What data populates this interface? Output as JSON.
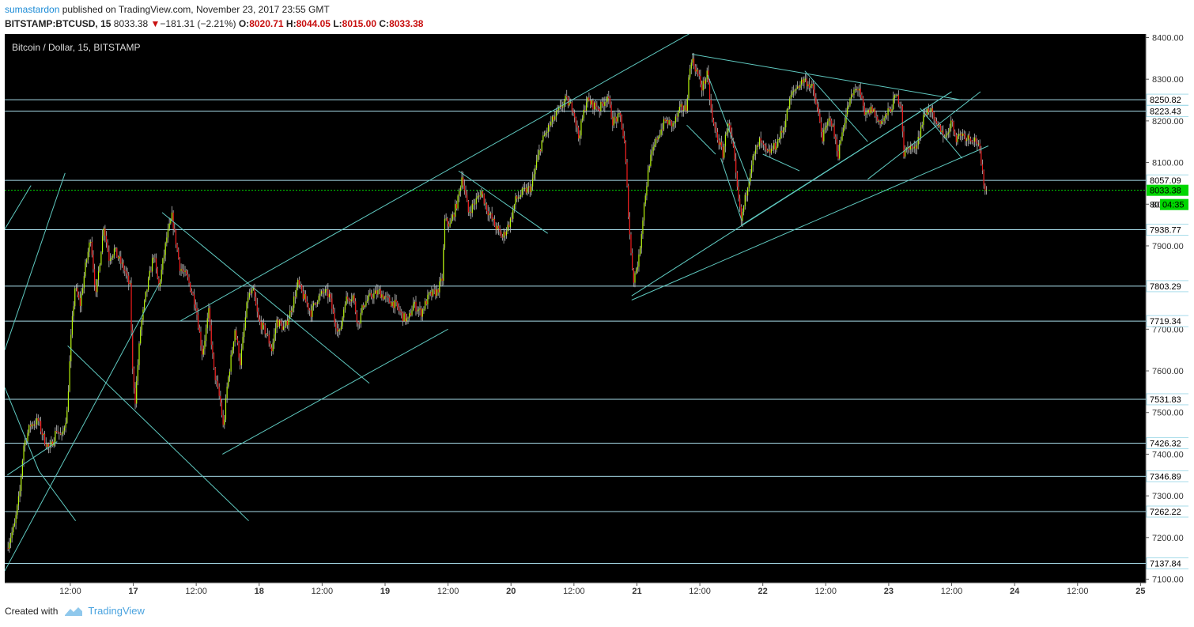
{
  "header": {
    "author": "sumastardon",
    "published_text": "published on TradingView.com, November 23, 2017 23:55 GMT",
    "symbol": "BITSTAMP:BTCUSD, 15",
    "last": "8033.38",
    "change_arrow": "▼",
    "change": "−181.31 (−2.21%)",
    "o_label": "O:",
    "o": "8020.71",
    "h_label": "H:",
    "h": "8044.05",
    "l_label": "L:",
    "l": "8015.00",
    "c_label": "C:",
    "c": "8033.38"
  },
  "footer": {
    "created_with": "Created with",
    "brand": "TradingView"
  },
  "colors": {
    "background": "#000000",
    "up": "#b7f50a",
    "down": "#f21b1b",
    "wick": "#bdbdbd",
    "drawing": "#5fc9c0",
    "hline": "#a8dcea",
    "price_label_bg": "#ffffff",
    "current_price_bg": "#00d600"
  },
  "chart_data": {
    "type": "candlestick",
    "title": "Bitcoin / Dollar, 15, BITSTAMP",
    "ylim": [
      7100,
      8400
    ],
    "y_ticks": [
      "8400.00",
      "8300.00",
      "8200.00",
      "8100.00",
      "8000.00",
      "7900.00",
      "7800.00",
      "7700.00",
      "7600.00",
      "7500.00",
      "7400.00",
      "7300.00",
      "7200.00",
      "7100.00"
    ],
    "x_ticks": [
      "12:00",
      "17",
      "12:00",
      "18",
      "12:00",
      "19",
      "12:00",
      "20",
      "12:00",
      "21",
      "12:00",
      "22",
      "12:00",
      "23",
      "12:00",
      "24",
      "12:00",
      "25"
    ],
    "x_tick_times_hours": [
      12,
      24,
      36,
      48,
      60,
      72,
      84,
      96,
      108,
      120,
      132,
      144,
      156,
      168,
      180,
      192,
      204,
      216
    ],
    "x_range_hours": [
      -0.5,
      217
    ],
    "horizontal_levels": [
      {
        "value": 8250.82,
        "label": "8250.82"
      },
      {
        "value": 8223.43,
        "label": "8223.43"
      },
      {
        "value": 8057.09,
        "label": "8057.09"
      },
      {
        "value": 7938.77,
        "label": "7938.77"
      },
      {
        "value": 7803.29,
        "label": "7803.29"
      },
      {
        "value": 7719.34,
        "label": "7719.34"
      },
      {
        "value": 7531.83,
        "label": "7531.83"
      },
      {
        "value": 7426.32,
        "label": "7426.32"
      },
      {
        "value": 7346.89,
        "label": "7346.89"
      },
      {
        "value": 7262.22,
        "label": "7262.22"
      },
      {
        "value": 7137.84,
        "label": "7137.84"
      }
    ],
    "current_price": {
      "value": 8033.38,
      "label": "8033.38",
      "countdown": "04:35",
      "countdown_prefix": "80"
    },
    "price_path_anchors": [
      [
        0,
        7175
      ],
      [
        1.5,
        7230
      ],
      [
        2.5,
        7310
      ],
      [
        3.2,
        7420
      ],
      [
        4.5,
        7470
      ],
      [
        6,
        7480
      ],
      [
        7,
        7440
      ],
      [
        8.2,
        7410
      ],
      [
        9.5,
        7460
      ],
      [
        10.5,
        7440
      ],
      [
        11.5,
        7500
      ],
      [
        12.3,
        7690
      ],
      [
        13,
        7800
      ],
      [
        14,
        7760
      ],
      [
        15,
        7850
      ],
      [
        16,
        7920
      ],
      [
        17,
        7780
      ],
      [
        18.5,
        7950
      ],
      [
        19.5,
        7870
      ],
      [
        20.5,
        7890
      ],
      [
        22.5,
        7840
      ],
      [
        23.5,
        7800
      ],
      [
        24,
        7600
      ],
      [
        24.5,
        7530
      ],
      [
        25.5,
        7700
      ],
      [
        26.5,
        7780
      ],
      [
        28,
        7880
      ],
      [
        29,
        7800
      ],
      [
        30.5,
        7920
      ],
      [
        31.5,
        7970
      ],
      [
        33,
        7850
      ],
      [
        34.5,
        7820
      ],
      [
        36,
        7760
      ],
      [
        37.3,
        7640
      ],
      [
        38.5,
        7740
      ],
      [
        39.5,
        7600
      ],
      [
        40.8,
        7520
      ],
      [
        41.3,
        7460
      ],
      [
        42,
        7560
      ],
      [
        43.5,
        7700
      ],
      [
        44.5,
        7620
      ],
      [
        46,
        7780
      ],
      [
        47,
        7790
      ],
      [
        48,
        7720
      ],
      [
        49.5,
        7690
      ],
      [
        50.5,
        7650
      ],
      [
        51.5,
        7720
      ],
      [
        53,
        7700
      ],
      [
        54.5,
        7760
      ],
      [
        55.5,
        7810
      ],
      [
        56.5,
        7780
      ],
      [
        58,
        7740
      ],
      [
        59,
        7770
      ],
      [
        60.5,
        7790
      ],
      [
        61.5,
        7780
      ],
      [
        62.5,
        7720
      ],
      [
        63.5,
        7690
      ],
      [
        64.5,
        7770
      ],
      [
        66,
        7780
      ],
      [
        67,
        7710
      ],
      [
        68,
        7760
      ],
      [
        69.5,
        7780
      ],
      [
        71,
        7790
      ],
      [
        72.5,
        7770
      ],
      [
        74,
        7760
      ],
      [
        75.5,
        7730
      ],
      [
        76.5,
        7720
      ],
      [
        77.5,
        7760
      ],
      [
        79,
        7740
      ],
      [
        80.5,
        7780
      ],
      [
        82,
        7790
      ],
      [
        83,
        7820
      ],
      [
        83.5,
        7960
      ],
      [
        84.5,
        7950
      ],
      [
        86,
        8010
      ],
      [
        86.8,
        8070
      ],
      [
        88,
        7980
      ],
      [
        89,
        8000
      ],
      [
        90.5,
        8030
      ],
      [
        91.5,
        7990
      ],
      [
        93,
        7950
      ],
      [
        94.5,
        7920
      ],
      [
        96,
        7960
      ],
      [
        97,
        8010
      ],
      [
        98.5,
        8030
      ],
      [
        100,
        8040
      ],
      [
        101,
        8100
      ],
      [
        102,
        8150
      ],
      [
        103.5,
        8190
      ],
      [
        105,
        8220
      ],
      [
        106.5,
        8250
      ],
      [
        108,
        8230
      ],
      [
        109,
        8160
      ],
      [
        110.5,
        8250
      ],
      [
        111.5,
        8240
      ],
      [
        113,
        8230
      ],
      [
        114.5,
        8260
      ],
      [
        115.5,
        8200
      ],
      [
        117,
        8210
      ],
      [
        117.8,
        8140
      ],
      [
        118.5,
        7980
      ],
      [
        119,
        7880
      ],
      [
        119.5,
        7820
      ],
      [
        120.5,
        7870
      ],
      [
        121.5,
        8000
      ],
      [
        122.5,
        8100
      ],
      [
        124,
        8160
      ],
      [
        125.5,
        8200
      ],
      [
        127,
        8190
      ],
      [
        128.5,
        8230
      ],
      [
        129.5,
        8230
      ],
      [
        130,
        8300
      ],
      [
        130.5,
        8350
      ],
      [
        131.5,
        8320
      ],
      [
        132.5,
        8280
      ],
      [
        133.5,
        8310
      ],
      [
        134.5,
        8200
      ],
      [
        135.5,
        8160
      ],
      [
        136.5,
        8120
      ],
      [
        137.5,
        8200
      ],
      [
        138.5,
        8130
      ],
      [
        139.2,
        8040
      ],
      [
        140,
        7960
      ],
      [
        141,
        8030
      ],
      [
        142,
        8100
      ],
      [
        143.5,
        8150
      ],
      [
        145,
        8120
      ],
      [
        146.5,
        8140
      ],
      [
        148,
        8180
      ],
      [
        149.5,
        8260
      ],
      [
        150.5,
        8280
      ],
      [
        152,
        8300
      ],
      [
        153.5,
        8280
      ],
      [
        154.5,
        8230
      ],
      [
        155.5,
        8160
      ],
      [
        157,
        8210
      ],
      [
        158.5,
        8120
      ],
      [
        159.5,
        8190
      ],
      [
        160.5,
        8240
      ],
      [
        161.5,
        8270
      ],
      [
        162.5,
        8280
      ],
      [
        163.5,
        8210
      ],
      [
        165,
        8230
      ],
      [
        166,
        8200
      ],
      [
        167,
        8200
      ],
      [
        168.5,
        8230
      ],
      [
        169.5,
        8260
      ],
      [
        170.5,
        8240
      ],
      [
        171,
        8120
      ],
      [
        172,
        8140
      ],
      [
        173,
        8130
      ],
      [
        174,
        8170
      ],
      [
        175,
        8220
      ],
      [
        176,
        8230
      ],
      [
        177,
        8190
      ],
      [
        178,
        8180
      ],
      [
        179,
        8160
      ],
      [
        180,
        8200
      ],
      [
        181,
        8160
      ],
      [
        182,
        8170
      ],
      [
        183,
        8160
      ],
      [
        184,
        8160
      ],
      [
        185,
        8150
      ],
      [
        185.5,
        8120
      ],
      [
        186,
        8070
      ],
      [
        186.6,
        8033
      ]
    ],
    "trend_lines": [
      [
        [
          -0.5,
          7940
        ],
        [
          4.5,
          8045
        ]
      ],
      [
        [
          -0.5,
          7650
        ],
        [
          11,
          8075
        ]
      ],
      [
        [
          -0.5,
          7560
        ],
        [
          6,
          7360
        ],
        [
          13,
          7240
        ]
      ],
      [
        [
          -0.5,
          7120
        ],
        [
          29,
          7810
        ]
      ],
      [
        [
          0,
          7350
        ],
        [
          9.5,
          7430
        ]
      ],
      [
        [
          11.5,
          7660
        ],
        [
          46,
          7240
        ]
      ],
      [
        [
          29.5,
          7980
        ],
        [
          69,
          7570
        ]
      ],
      [
        [
          41,
          7400
        ],
        [
          84,
          7700
        ]
      ],
      [
        [
          33,
          7720
        ],
        [
          131.5,
          8420
        ]
      ],
      [
        [
          86,
          8080
        ],
        [
          103,
          7930
        ]
      ],
      [
        [
          119,
          7770
        ],
        [
          187,
          8140
        ]
      ],
      [
        [
          119,
          7780
        ],
        [
          180,
          8270
        ]
      ],
      [
        [
          129.5,
          8190
        ],
        [
          135,
          8120
        ]
      ],
      [
        [
          130.5,
          8360
        ],
        [
          182,
          8250
        ]
      ],
      [
        [
          133.5,
          8310
        ],
        [
          141.5,
          8050
        ]
      ],
      [
        [
          136,
          8110
        ],
        [
          140,
          7960
        ]
      ],
      [
        [
          140,
          7950
        ],
        [
          180,
          8270
        ]
      ],
      [
        [
          152,
          8320
        ],
        [
          164,
          8150
        ]
      ],
      [
        [
          164,
          8060
        ],
        [
          185.5,
          8270
        ]
      ],
      [
        [
          144,
          8120
        ],
        [
          151,
          8080
        ]
      ],
      [
        [
          174,
          8230
        ],
        [
          182,
          8110
        ]
      ]
    ]
  }
}
